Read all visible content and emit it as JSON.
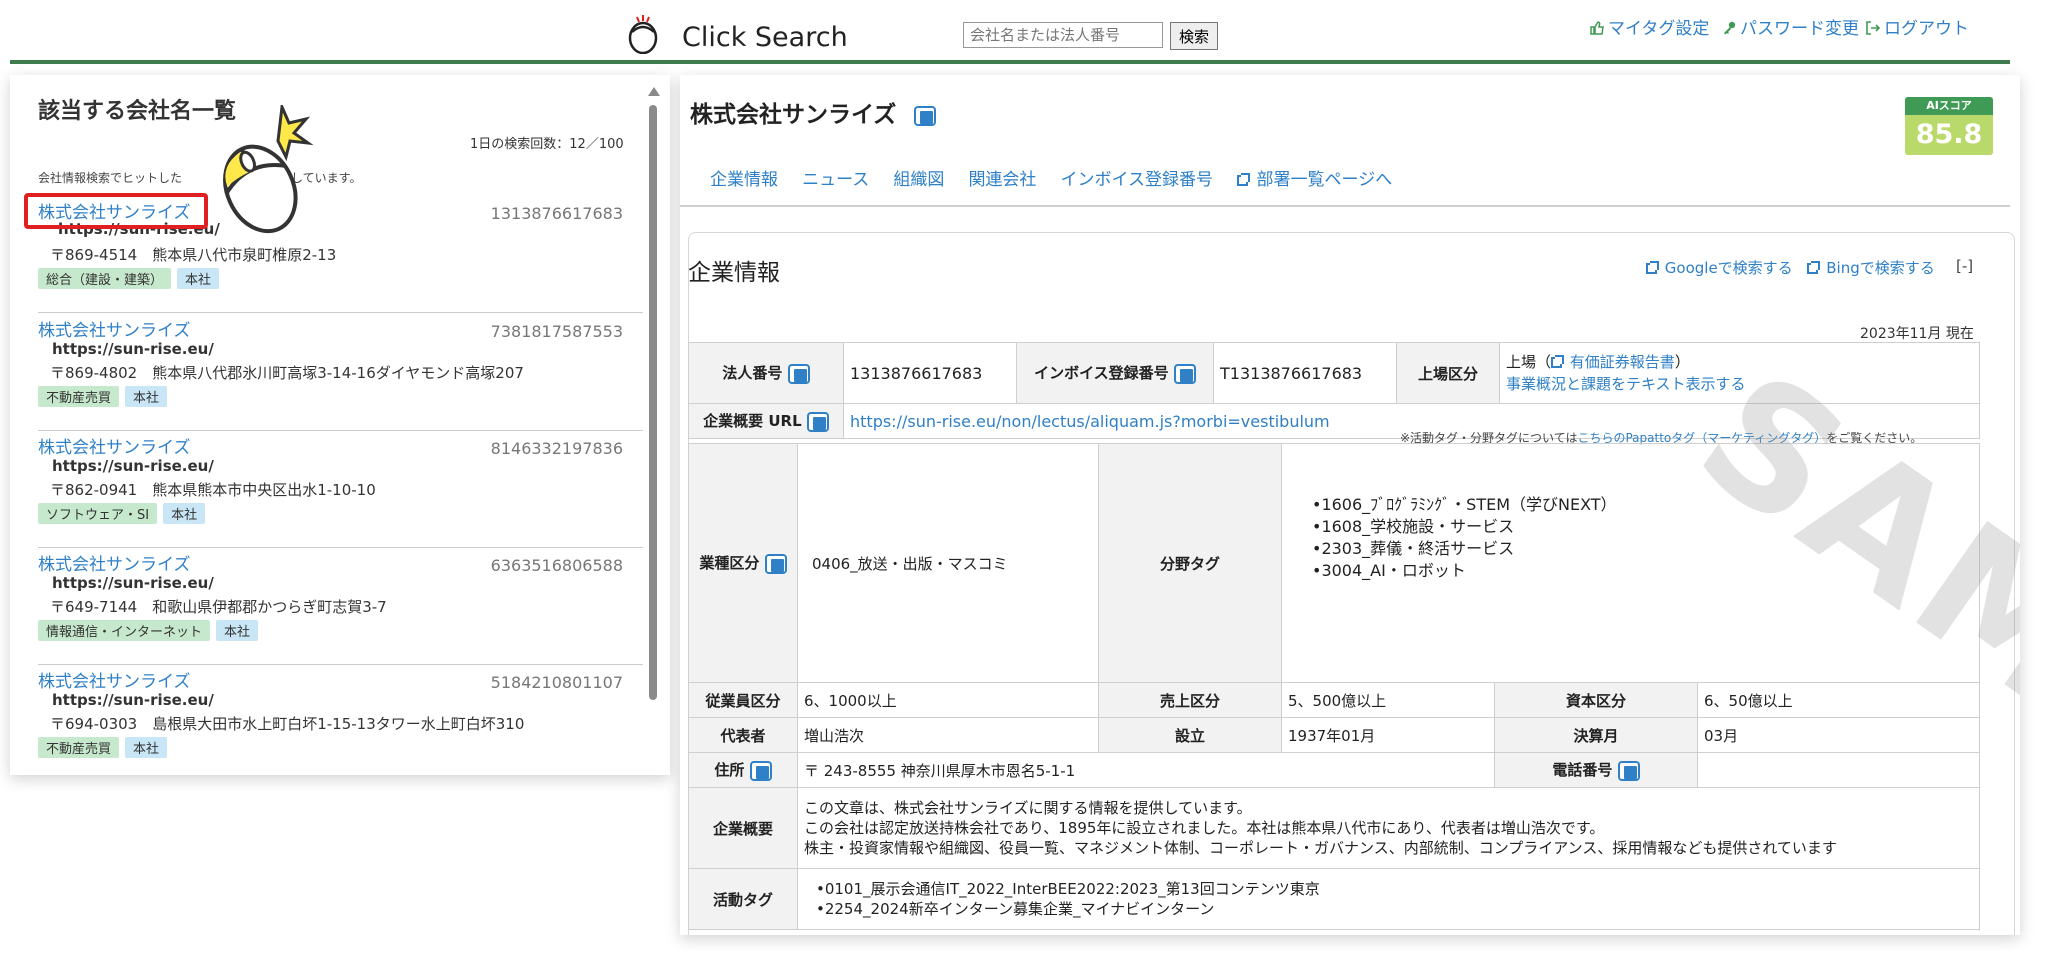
{
  "header": {
    "app_title": "Click Search",
    "search_placeholder": "会社名または法人番号",
    "search_button": "検索",
    "links": {
      "my_tag": "マイタグ設定",
      "password": "パスワード変更",
      "logout": "ログアウト"
    }
  },
  "left": {
    "title": "該当する会社名一覧",
    "search_count": "1日の検索回数：12／100",
    "note": "会社情報検索でヒットした",
    "note_tail": "表示しています。",
    "results": [
      {
        "name": "株式会社サンライズ",
        "number": "1313876617683",
        "url": "https://sun-rise.eu/",
        "address": "〒869-4514　熊本県八代市泉町椎原2-13",
        "tags": [
          "総合（建設・建築）",
          "本社"
        ]
      },
      {
        "name": "株式会社サンライズ",
        "number": "7381817587553",
        "url": "https://sun-rise.eu/",
        "address": "〒869-4802　熊本県八代郡氷川町高塚3-14-16ダイヤモンド高塚207",
        "tags": [
          "不動産売買",
          "本社"
        ]
      },
      {
        "name": "株式会社サンライズ",
        "number": "8146332197836",
        "url": "https://sun-rise.eu/",
        "address": "〒862-0941　熊本県熊本市中央区出水1-10-10",
        "tags": [
          "ソフトウェア・SI",
          "本社"
        ]
      },
      {
        "name": "株式会社サンライズ",
        "number": "6363516806588",
        "url": "https://sun-rise.eu/",
        "address": "〒649-7144　和歌山県伊都郡かつらぎ町志賀3-7",
        "tags": [
          "情報通信・インターネット",
          "本社"
        ]
      },
      {
        "name": "株式会社サンライズ",
        "number": "5184210801107",
        "url": "https://sun-rise.eu/",
        "address": "〒694-0303　島根県大田市水上町白坏1-15-13タワー水上町白坏310",
        "tags": [
          "不動産売買",
          "本社"
        ]
      }
    ]
  },
  "right": {
    "company_name": "株式会社サンライズ",
    "ai_score_label": "AIスコア",
    "ai_score": "85.8",
    "tabs": [
      "企業情報",
      "ニュース",
      "組織図",
      "関連会社",
      "インボイス登録番号",
      "部署一覧ページへ"
    ],
    "section_title": "企業情報",
    "google_search": "Googleで検索する",
    "bing_search": "Bingで検索する",
    "collapse": "[-]",
    "date": "2023年11月 現在",
    "table1": {
      "corp_number_label": "法人番号",
      "corp_number": "1313876617683",
      "invoice_label": "インボイス登録番号",
      "invoice": "T1313876617683",
      "listing_label": "上場区分",
      "listing": "上場（",
      "securities_report": "有価証券報告書",
      "listing_close": "）",
      "business_text_link": "事業概況と課題をテキスト表示する",
      "url_label": "企業概要 URL",
      "url": "https://sun-rise.eu/non/lectus/aliquam.js?morbi=vestibulum"
    },
    "tag_note_pre": "※活動タグ・分野タグについては",
    "tag_note_link": "こちらのPapattoタグ（マーケティングタグ）",
    "tag_note_post": "をご覧ください。",
    "table2": {
      "industry_label": "業種区分",
      "industry": "0406_放送・出版・マスコミ",
      "field_tag_label": "分野タグ",
      "field_tags": [
        "•1606_ﾌﾞﾛｸﾞﾗﾐﾝｸﾞ・STEM（学びNEXT）",
        "•1608_学校施設・サービス",
        "•2303_葬儀・終活サービス",
        "•3004_AI・ロボット"
      ],
      "employees_label": "従業員区分",
      "employees": "6、1000以上",
      "sales_label": "売上区分",
      "sales": "5、500億以上",
      "capital_label": "資本区分",
      "capital": "6、50億以上",
      "rep_label": "代表者",
      "rep": "増山浩次",
      "founded_label": "設立",
      "founded": "1937年01月",
      "fiscal_label": "決算月",
      "fiscal": "03月",
      "address_label": "住所",
      "address": "〒 243-8555 神奈川県厚木市恩名5-1-1",
      "phone_label": "電話番号",
      "phone": "",
      "summary_label": "企業概要",
      "summary_lines": [
        "この文章は、株式会社サンライズに関する情報を提供しています。",
        "この会社は認定放送持株会社であり、1895年に設立されました。本社は熊本県八代市にあり、代表者は増山浩次です。",
        "株主・投資家情報や組織図、役員一覧、マネジメント体制、コーポレート・ガバナンス、内部統制、コンプライアンス、採用情報なども提供されています"
      ],
      "activity_label": "活動タグ",
      "activity_tags": [
        "•0101_展示会通信IT_2022_InterBEE2022:2023_第13回コンテンツ東京",
        "•2254_2024新卒インターン募集企業_マイナビインターン"
      ]
    },
    "watermark": "SAMPLE"
  },
  "colors": {
    "accent": "#2f80c7",
    "header_line": "#3d7a4c",
    "highlight": "#e02020",
    "ai_green": "#3f9a56"
  }
}
